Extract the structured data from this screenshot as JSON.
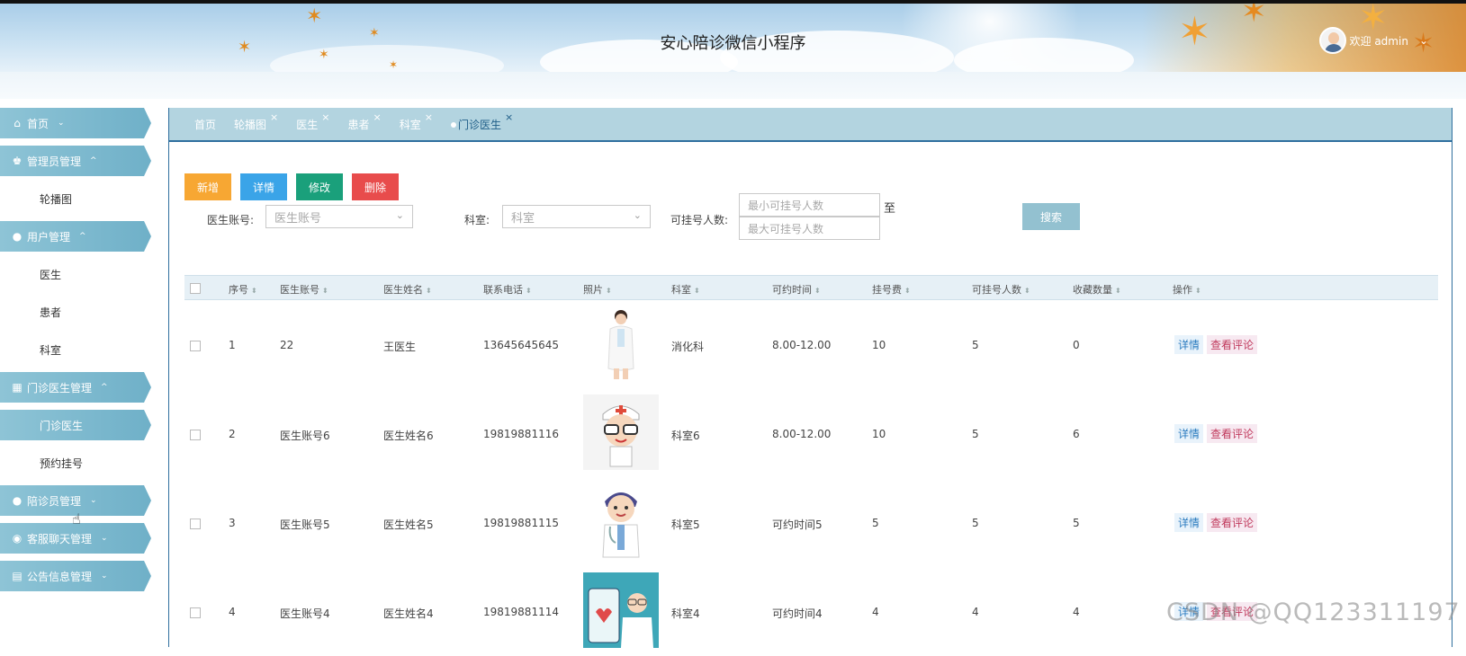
{
  "header": {
    "app_title": "安心陪诊微信小程序",
    "welcome_text": "欢迎 admin",
    "user_menu_chevron": "⌄"
  },
  "sidebar": {
    "items": [
      {
        "type": "head",
        "icon": "home-icon",
        "label": "首页",
        "chevron": "⌄"
      },
      {
        "type": "head",
        "icon": "admin-icon",
        "label": "管理员管理",
        "chevron": "^"
      },
      {
        "type": "sub",
        "label": "轮播图"
      },
      {
        "type": "head",
        "icon": "user-icon",
        "label": "用户管理",
        "chevron": "^"
      },
      {
        "type": "sub",
        "label": "医生"
      },
      {
        "type": "sub",
        "label": "患者"
      },
      {
        "type": "sub",
        "label": "科室"
      },
      {
        "type": "head",
        "icon": "building-icon",
        "label": "门诊医生管理",
        "chevron": "^"
      },
      {
        "type": "sub",
        "label": "门诊医生",
        "active": true
      },
      {
        "type": "sub",
        "label": "预约挂号"
      },
      {
        "type": "head",
        "icon": "user-icon",
        "label": "陪诊员管理",
        "chevron": "⌄"
      },
      {
        "type": "head",
        "icon": "chat-icon",
        "label": "客服聊天管理",
        "chevron": "⌄"
      },
      {
        "type": "head",
        "icon": "notice-icon",
        "label": "公告信息管理",
        "chevron": "⌄"
      }
    ]
  },
  "tabs": [
    {
      "label": "首页",
      "closable": false
    },
    {
      "label": "轮播图",
      "closable": true
    },
    {
      "label": "医生",
      "closable": true
    },
    {
      "label": "患者",
      "closable": true
    },
    {
      "label": "科室",
      "closable": true
    },
    {
      "label": "门诊医生",
      "closable": true,
      "active": true
    }
  ],
  "tab_close_glyph": "×",
  "toolbar": {
    "add_label": "新增",
    "detail_label": "详情",
    "edit_label": "修改",
    "delete_label": "删除"
  },
  "filters": {
    "account_label": "医生账号:",
    "account_placeholder": "医生账号",
    "dept_label": "科室:",
    "dept_placeholder": "科室",
    "count_label": "可挂号人数:",
    "min_placeholder": "最小可挂号人数",
    "max_placeholder": "最大可挂号人数",
    "to_label": "至",
    "search_label": "搜索"
  },
  "table": {
    "columns": [
      "序号",
      "医生账号",
      "医生姓名",
      "联系电话",
      "照片",
      "科室",
      "可约时间",
      "挂号费",
      "可挂号人数",
      "收藏数量",
      "操作"
    ],
    "rows": [
      {
        "no": "1",
        "account": "22",
        "name": "王医生",
        "phone": "13645645645",
        "photo": "female-doctor",
        "dept": "消化科",
        "time": "8.00-12.00",
        "fee": "10",
        "count": "5",
        "fav": "0"
      },
      {
        "no": "2",
        "account": "医生账号6",
        "name": "医生姓名6",
        "phone": "19819881116",
        "photo": "cartoon-doctor-glasses",
        "dept": "科室6",
        "time": "8.00-12.00",
        "fee": "10",
        "count": "5",
        "fav": "6"
      },
      {
        "no": "3",
        "account": "医生账号5",
        "name": "医生姓名5",
        "phone": "19819881115",
        "photo": "cartoon-doctor",
        "dept": "科室5",
        "time": "可约时间5",
        "fee": "5",
        "count": "5",
        "fav": "5"
      },
      {
        "no": "4",
        "account": "医生账号4",
        "name": "医生姓名4",
        "phone": "19819881114",
        "photo": "doctor-with-phone",
        "dept": "科室4",
        "time": "可约时间4",
        "fee": "4",
        "count": "4",
        "fav": "4"
      }
    ],
    "op_detail_label": "详情",
    "op_comment_label": "查看评论"
  },
  "watermark": "CSDN @QQ123311197",
  "colors": {
    "accent": "#6fb0c8",
    "tab_bar": "#b3d4e0",
    "border": "#2f6f9e",
    "btn_add": "#f7a733",
    "btn_detail": "#3aa4e8",
    "btn_edit": "#1aa07b",
    "btn_delete": "#e84c4c",
    "btn_search": "#93c1d0"
  }
}
